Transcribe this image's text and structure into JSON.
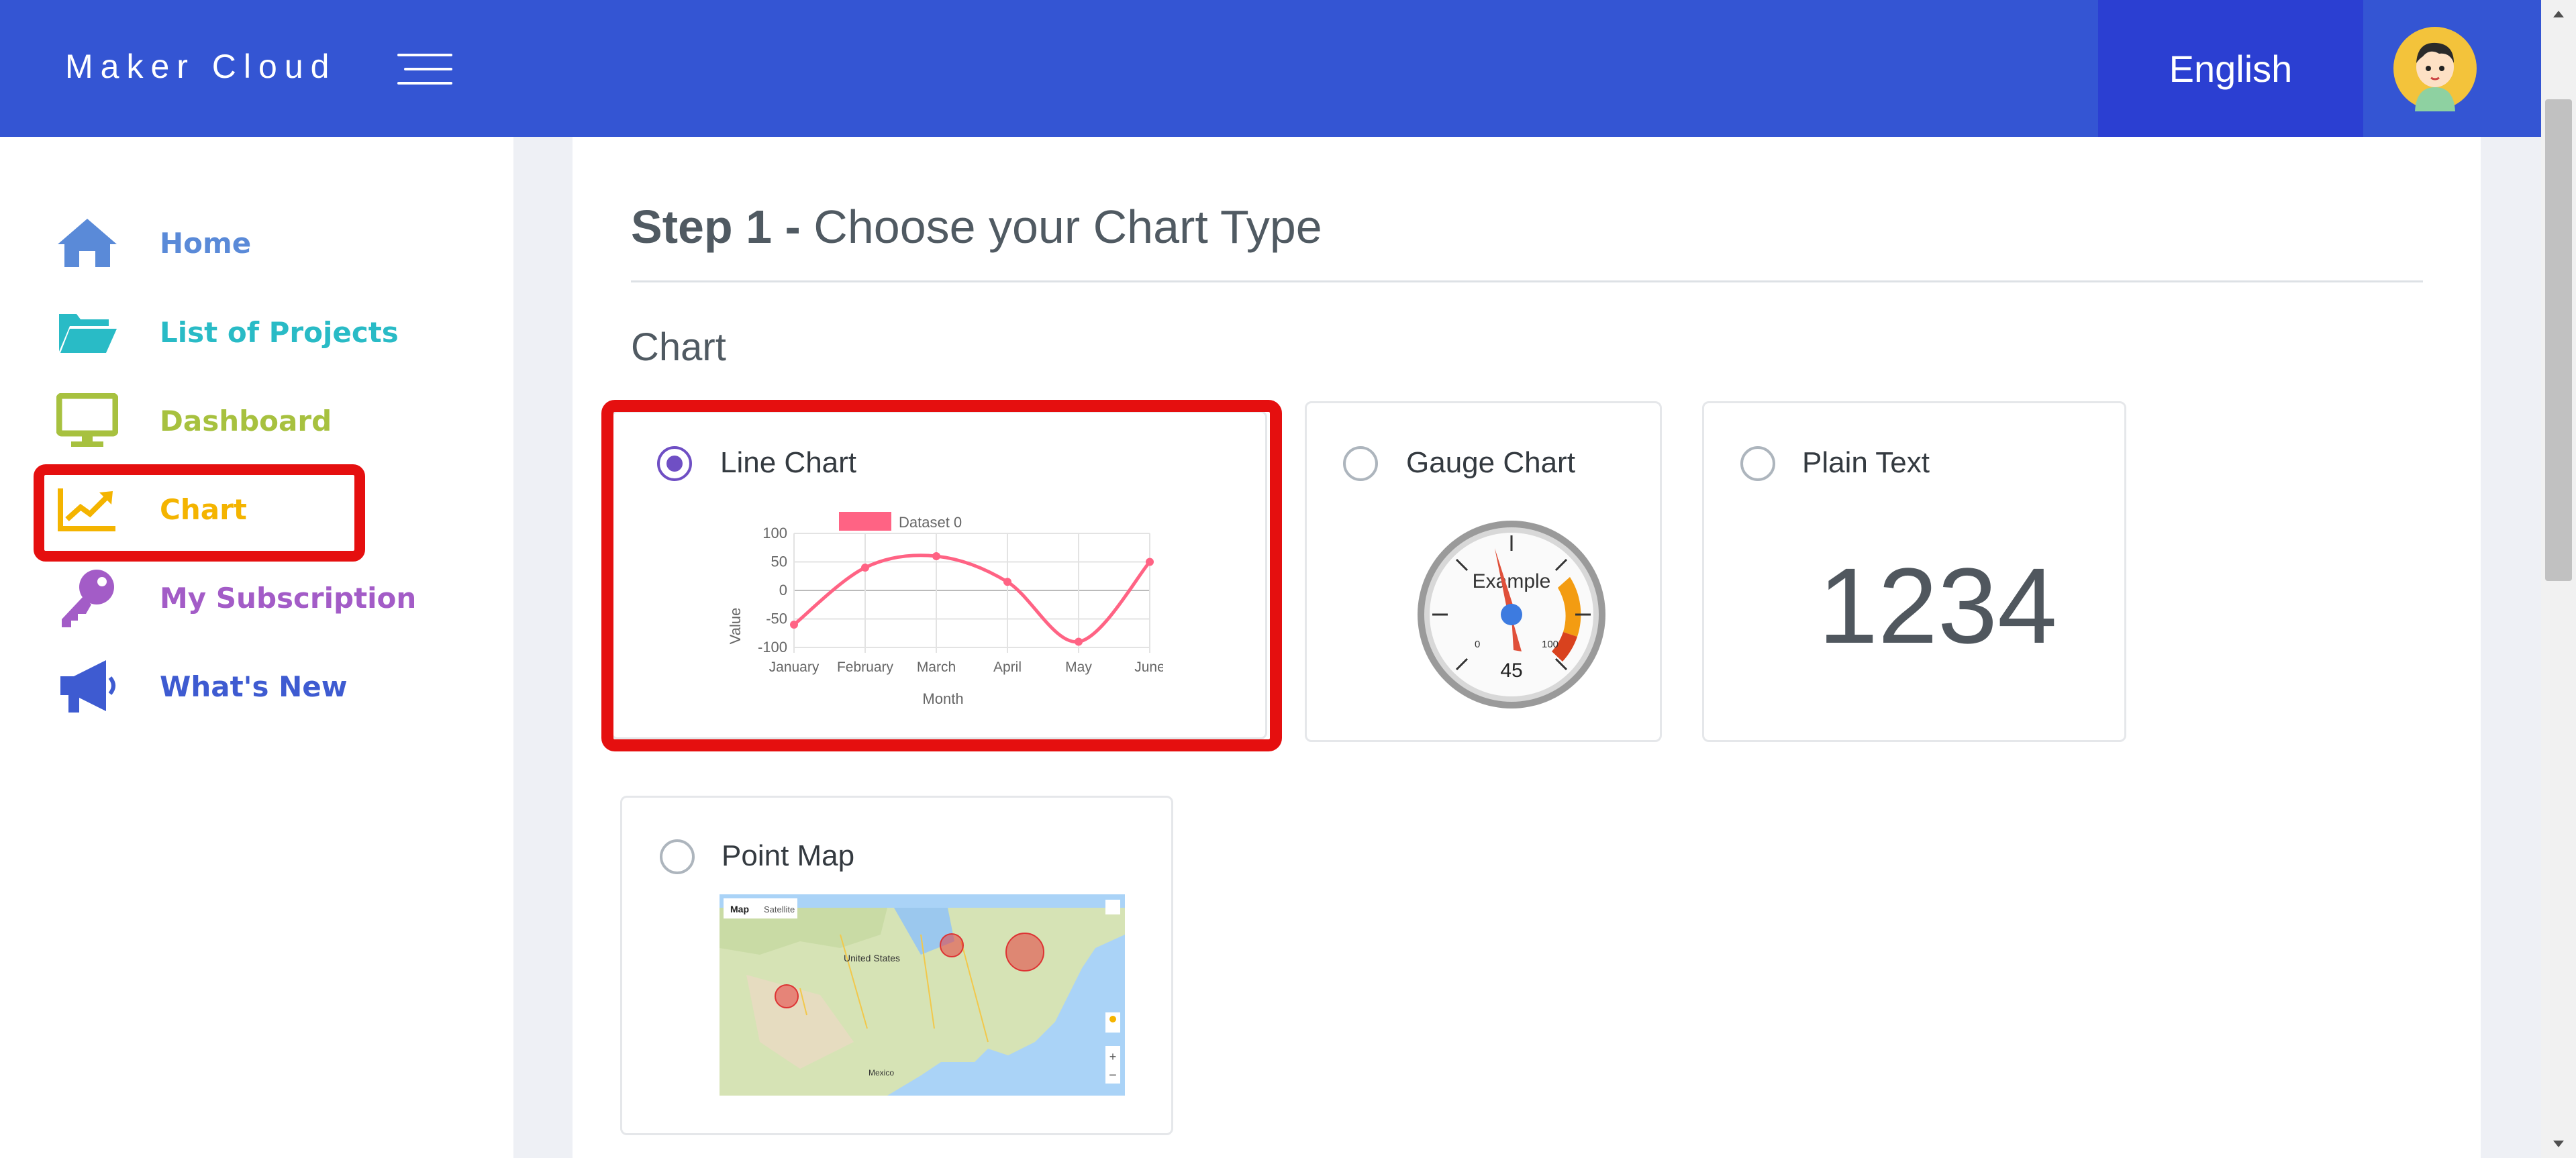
{
  "header": {
    "brand": "Maker Cloud",
    "language": "English"
  },
  "sidebar": {
    "items": [
      {
        "label": "Home",
        "icon": "home-icon",
        "color": "#5a8ad8"
      },
      {
        "label": "List of Projects",
        "icon": "folder-open-icon",
        "color": "#29bbc6"
      },
      {
        "label": "Dashboard",
        "icon": "monitor-icon",
        "color": "#a7c13f"
      },
      {
        "label": "Chart",
        "icon": "line-chart-icon",
        "color": "#f4b400"
      },
      {
        "label": "My Subscription",
        "icon": "key-icon",
        "color": "#a35cc7"
      },
      {
        "label": "What's New",
        "icon": "megaphone-icon",
        "color": "#3e5bd1"
      }
    ],
    "active": "Chart"
  },
  "main": {
    "step_prefix": "Step 1 -",
    "step_title": "Choose your Chart Type",
    "section": "Chart",
    "options": [
      {
        "label": "Line Chart",
        "selected": true
      },
      {
        "label": "Gauge Chart",
        "selected": false
      },
      {
        "label": "Plain Text",
        "selected": false
      },
      {
        "label": "Point Map",
        "selected": false
      }
    ]
  },
  "previews": {
    "line_chart": {
      "legend": "Dataset 0",
      "ylabel": "Value",
      "xlabel": "Month",
      "yticks": [
        "100",
        "50",
        "0",
        "-50",
        "-100"
      ]
    },
    "gauge": {
      "label": "Example",
      "value": "45",
      "min": "0",
      "max": "100"
    },
    "plain_text": {
      "value": "1234"
    },
    "map": {
      "tab_map": "Map",
      "tab_satellite": "Satellite",
      "country": "United States",
      "mexico": "Mexico"
    }
  },
  "chart_data": {
    "type": "line",
    "categories": [
      "January",
      "February",
      "March",
      "April",
      "May",
      "June"
    ],
    "series": [
      {
        "name": "Dataset 0",
        "values": [
          -60,
          40,
          60,
          15,
          -90,
          50
        ],
        "color": "#ff6384"
      }
    ],
    "xlabel": "Month",
    "ylabel": "Value",
    "ylim": [
      -100,
      100
    ],
    "grid": true,
    "legend": "top"
  }
}
